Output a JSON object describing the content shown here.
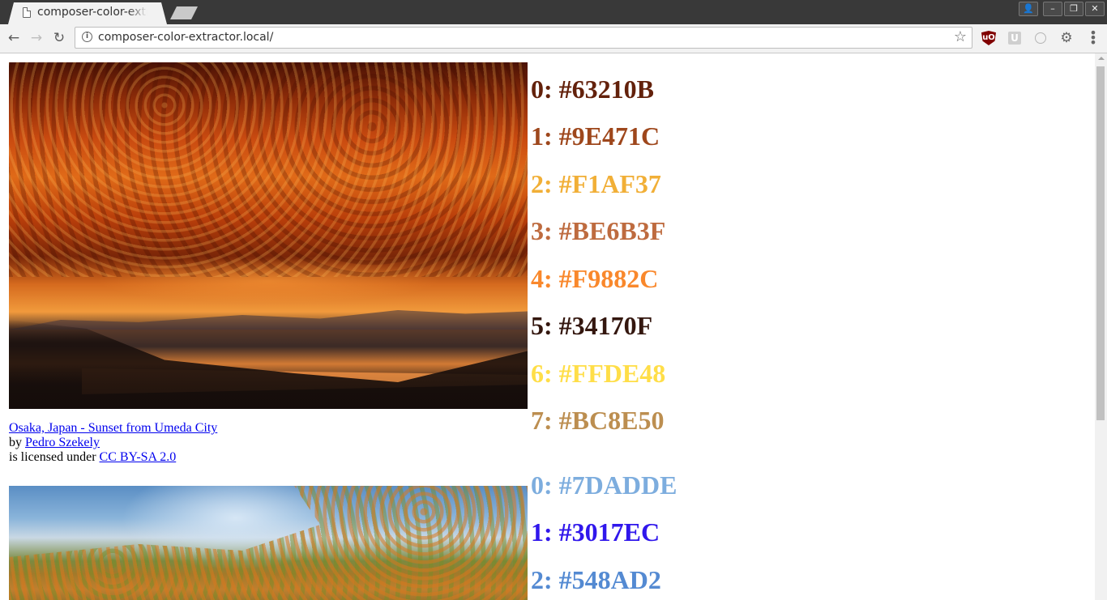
{
  "browser": {
    "tab_title": "composer-color-extractor.local",
    "tab_close": "×",
    "url": "composer-color-extractor.local/",
    "window_buttons": {
      "profile": "👤",
      "minimize": "–",
      "restore": "❐",
      "close": "✕"
    },
    "nav": {
      "back": "←",
      "forward": "→",
      "reload": "↻"
    },
    "info_icon": "i",
    "bookmark_star": "☆",
    "extensions": {
      "ublock": "uO",
      "u": "U",
      "ring": "",
      "gear": "⚙"
    },
    "menu": "⋮"
  },
  "images": [
    {
      "alt": "sunset photo",
      "caption": {
        "title_link": "Osaka, Japan - Sunset from Umeda City",
        "by_text": "by",
        "author_link": "Pedro Szekely",
        "license_text": "is licensed under",
        "license_link": "CC BY-SA 2.0"
      },
      "colors": [
        {
          "label": "0: #63210B",
          "hex": "#63210B"
        },
        {
          "label": "1: #9E471C",
          "hex": "#9E471C"
        },
        {
          "label": "2: #F1AF37",
          "hex": "#F1AF37"
        },
        {
          "label": "3: #BE6B3F",
          "hex": "#BE6B3F"
        },
        {
          "label": "4: #F9882C",
          "hex": "#F9882C"
        },
        {
          "label": "5: #34170F",
          "hex": "#34170F"
        },
        {
          "label": "6: #FFDE48",
          "hex": "#FFDE48"
        },
        {
          "label": "7: #BC8E50",
          "hex": "#BC8E50"
        }
      ]
    },
    {
      "alt": "autumn forest photo",
      "colors": [
        {
          "label": "0: #7DADDE",
          "hex": "#7DADDE"
        },
        {
          "label": "1: #3017EC",
          "hex": "#3017EC"
        },
        {
          "label": "2: #548AD2",
          "hex": "#548AD2"
        }
      ]
    }
  ]
}
